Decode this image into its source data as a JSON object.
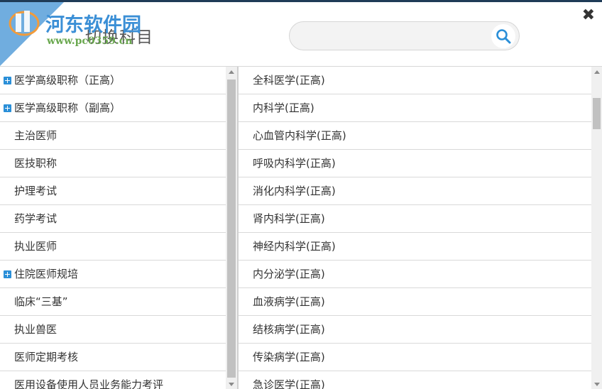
{
  "dialog": {
    "title": "切换科目",
    "close_label": "✖"
  },
  "search": {
    "value": "",
    "placeholder": "",
    "icon": "search-icon"
  },
  "watermark": {
    "name": "河东软件园",
    "url": "www.pc0359.cn"
  },
  "categories": [
    {
      "label": "医学高级职称（正高）",
      "expandable": true
    },
    {
      "label": "医学高级职称（副高）",
      "expandable": true
    },
    {
      "label": "主治医师",
      "expandable": false
    },
    {
      "label": "医技职称",
      "expandable": false
    },
    {
      "label": "护理考试",
      "expandable": false
    },
    {
      "label": "药学考试",
      "expandable": false
    },
    {
      "label": "执业医师",
      "expandable": false
    },
    {
      "label": "住院医师规培",
      "expandable": true
    },
    {
      "label": "临床“三基”",
      "expandable": false
    },
    {
      "label": "执业兽医",
      "expandable": false
    },
    {
      "label": "医师定期考核",
      "expandable": false
    },
    {
      "label": "医用设备使用人员业务能力考评",
      "expandable": false
    }
  ],
  "subjects": [
    "全科医学(正高)",
    "内科学(正高)",
    "心血管内科学(正高)",
    "呼吸内科学(正高)",
    "消化内科学(正高)",
    "肾内科学(正高)",
    "神经内科学(正高)",
    "内分泌学(正高)",
    "血液病学(正高)",
    "结核病学(正高)",
    "传染病学(正高)",
    "急诊医学(正高)"
  ],
  "colors": {
    "accent": "#2a8fd8",
    "top_line": "#1f3b57"
  }
}
